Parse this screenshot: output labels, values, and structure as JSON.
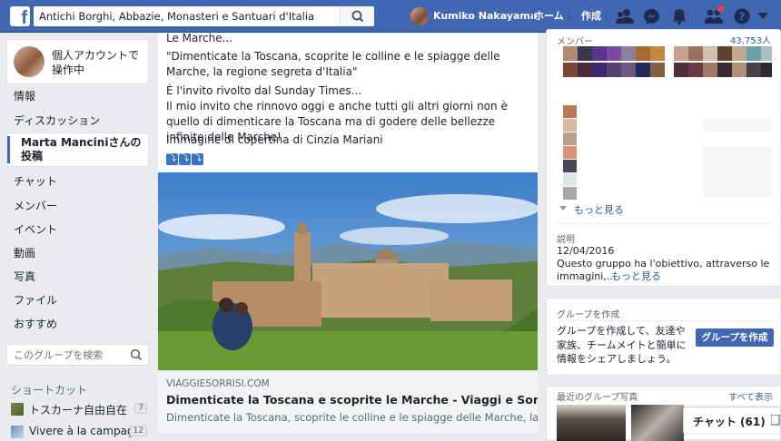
{
  "topbar": {
    "search_value": "Antichi Borghi, Abbazie, Monasteri e Santuari d'Italia",
    "user_name": "Kumiko Nakayama",
    "home_label": "ホーム",
    "create_label": "作成"
  },
  "sidebar": {
    "account_switch": "個人アカウントで操作中",
    "nav": [
      "情報",
      "ディスカッション",
      "Marta Manciniさんの 投稿",
      "チャット",
      "メンバー",
      "イベント",
      "動画",
      "写真",
      "ファイル",
      "おすすめ"
    ],
    "search_placeholder": "このグループを検索",
    "shortcuts_title": "ショートカット",
    "shortcuts": [
      {
        "label": "トスカーナ自由自在",
        "count": "7"
      },
      {
        "label": "Vivere à la campagne",
        "count": "12"
      }
    ]
  },
  "post": {
    "lines": [
      "Le Marche...",
      "\"Dimenticate la Toscana, scoprite le colline e le spiagge delle Marche, la regione segreta d'Italia\"",
      "È l'invito rivolto dal Sunday Times...",
      "Il mio invito che rinnovo oggi e anche tutti gli altri giorni non è quello di dimenticare la Toscana ma di godere delle bellezze infinite delle Marche!",
      "Immagine di copertina di Cinzia Mariani"
    ],
    "emoji": [
      "⤵",
      "⤵",
      "⤵"
    ],
    "link_domain": "VIAGGIESORRISI.COM",
    "link_title": "Dimenticate la Toscana e scoprite le Marche - Viaggi e Sorrisi",
    "link_desc": "Dimenticate la Toscana, scoprite le colline e le spiagge delle Marche, la..."
  },
  "members": {
    "title": "メンバー",
    "count": "43,753人",
    "see_more": "もっと見る"
  },
  "description": {
    "title": "説明",
    "date": "12/04/2016",
    "text": "Questo gruppo ha l'obiettivo, attraverso le immagini,...",
    "see_more": "もっと見る"
  },
  "create_group": {
    "title": "グループを作成",
    "text": "グループを作成して、友達や家族、チームメイトと簡単に情報をシェアしましょう。",
    "button": "グループを作成"
  },
  "recent_photos": {
    "title": "最近のグループ写真",
    "see_all": "すべて表示"
  },
  "chat": {
    "label": "チャット (61)"
  },
  "colors": {
    "brand": "#4267b2",
    "link": "#365899",
    "button": "#4267b2",
    "notification": "#fa3e3e"
  }
}
